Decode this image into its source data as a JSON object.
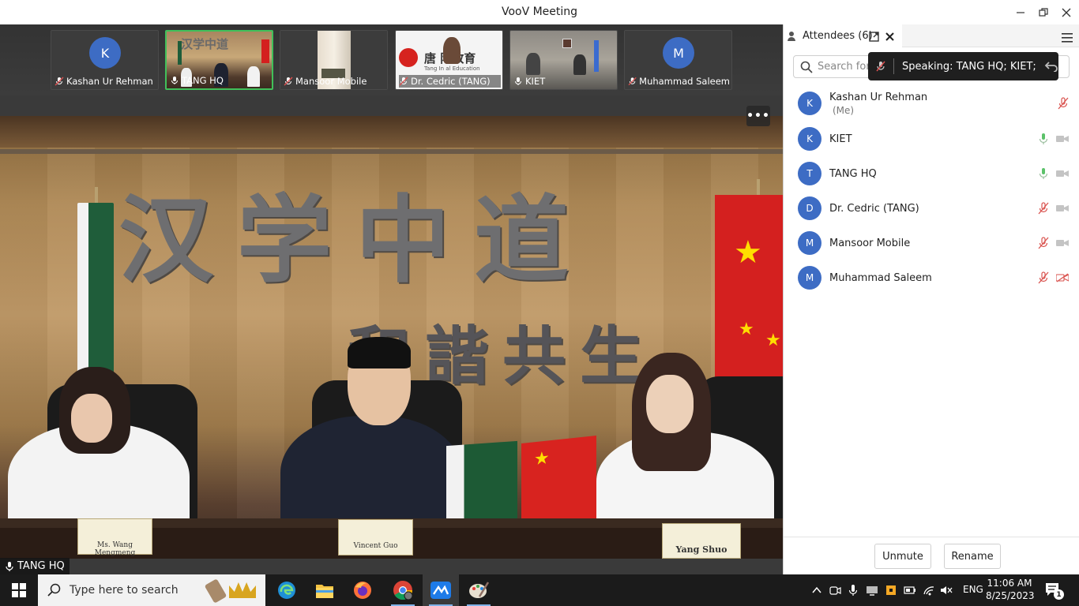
{
  "window": {
    "title": "VooV Meeting",
    "controls": {
      "minimize": "—",
      "restore": "❐",
      "close": "✕"
    }
  },
  "thumbnails": [
    {
      "name": "Kashan Ur Rehman",
      "initial": "K",
      "type": "avatar",
      "mic": "muted"
    },
    {
      "name": "TANG HQ",
      "type": "video",
      "mic": "on",
      "active": true
    },
    {
      "name": "Mansoor Mobile",
      "type": "video",
      "mic": "muted"
    },
    {
      "name": "Dr. Cedric (TANG)",
      "type": "video",
      "mic": "muted",
      "overlay_text": "唐 际教育",
      "overlay_sub": "Tang In  al Education"
    },
    {
      "name": "KIET",
      "type": "video",
      "mic": "on"
    },
    {
      "name": "Muhammad Saleem",
      "initial": "M",
      "type": "avatar",
      "mic": "muted"
    }
  ],
  "main_video": {
    "speaker_label": "TANG HQ",
    "more_label": "•••",
    "calligraphy": "汉学中道",
    "calligraphy2": "和諧共生",
    "nameplates": [
      "Ms. Wang Mengmeng",
      "Vincent Guo",
      "Yang Shuo"
    ]
  },
  "panel": {
    "tab_label": "Attendees (6)",
    "search_placeholder": "Search for",
    "speaking_text": "Speaking: TANG HQ; KIET;",
    "attendees": [
      {
        "initial": "K",
        "name": "Kashan Ur Rehman",
        "sub": "(Me)",
        "mic": "muted",
        "cam": "none"
      },
      {
        "initial": "K",
        "name": "KIET",
        "mic": "on",
        "cam": "on"
      },
      {
        "initial": "T",
        "name": "TANG HQ",
        "mic": "on",
        "cam": "on"
      },
      {
        "initial": "D",
        "name": "Dr. Cedric (TANG)",
        "mic": "muted",
        "cam": "on"
      },
      {
        "initial": "M",
        "name": "Mansoor Mobile",
        "mic": "muted",
        "cam": "on"
      },
      {
        "initial": "M",
        "name": "Muhammad Saleem",
        "mic": "muted",
        "cam": "off"
      }
    ],
    "buttons": {
      "unmute": "Unmute",
      "rename": "Rename"
    }
  },
  "taskbar": {
    "search_placeholder": "Type here to search",
    "apps": [
      "edge-icon",
      "file-explorer-icon",
      "firefox-icon",
      "chrome-icon",
      "voov-icon",
      "paint-icon"
    ],
    "language": "ENG",
    "time": "11:06 AM",
    "date": "8/25/2023",
    "notification_count": "1"
  },
  "colors": {
    "avatar_blue": "#3d6cc4",
    "active_green": "#41c05a",
    "mic_on_green": "#5cc26a",
    "muted_red": "#d9534f"
  }
}
